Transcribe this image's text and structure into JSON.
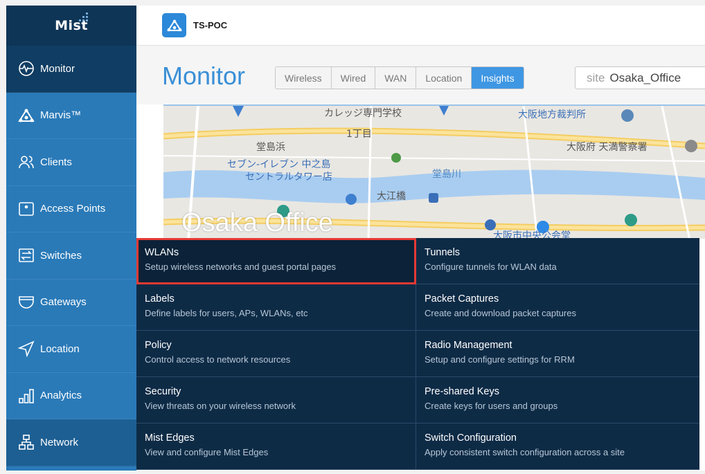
{
  "logo": {
    "text": "Mist"
  },
  "sidebar": {
    "items": [
      {
        "label": "Monitor",
        "icon": "monitor-icon",
        "state": "active"
      },
      {
        "label": "Marvis™",
        "icon": "marvis-icon",
        "state": ""
      },
      {
        "label": "Clients",
        "icon": "clients-icon",
        "state": ""
      },
      {
        "label": "Access Points",
        "icon": "access-point-icon",
        "state": ""
      },
      {
        "label": "Switches",
        "icon": "switch-icon",
        "state": ""
      },
      {
        "label": "Gateways",
        "icon": "gateway-icon",
        "state": ""
      },
      {
        "label": "Location",
        "icon": "location-icon",
        "state": ""
      },
      {
        "label": "Analytics",
        "icon": "analytics-icon",
        "state": ""
      },
      {
        "label": "Network",
        "icon": "network-icon",
        "state": "hover"
      }
    ]
  },
  "topbar": {
    "org_name": "TS-POC"
  },
  "header": {
    "title": "Monitor",
    "tabs": [
      "Wireless",
      "Wired",
      "WAN",
      "Location",
      "Insights"
    ],
    "active_tab": "Insights",
    "site_label": "site",
    "site_value": "Osaka_Office"
  },
  "map": {
    "site_title": "Osaka Office",
    "labels": {
      "l1": "カレッジ専門学校",
      "l2": "大阪地方裁判所",
      "l3": "1丁目",
      "l4": "堂島浜",
      "l5": "大阪府 天満警察署",
      "l6": "セブン-イレブン 中之島",
      "l7": "セントラルタワー店",
      "l8": "堂島川",
      "l9": "大江橋",
      "l10": "大阪市中央公会堂"
    }
  },
  "menu": {
    "items": [
      {
        "title": "WLANs",
        "desc": "Setup wireless networks and guest portal pages"
      },
      {
        "title": "Tunnels",
        "desc": "Configure tunnels for WLAN data"
      },
      {
        "title": "Labels",
        "desc": "Define labels for users, APs, WLANs, etc"
      },
      {
        "title": "Packet Captures",
        "desc": "Create and download packet captures"
      },
      {
        "title": "Policy",
        "desc": "Control access to network resources"
      },
      {
        "title": "Radio Management",
        "desc": "Setup and configure settings for RRM"
      },
      {
        "title": "Security",
        "desc": "View threats on your wireless network"
      },
      {
        "title": "Pre-shared Keys",
        "desc": "Create keys for users and groups"
      },
      {
        "title": "Mist Edges",
        "desc": "View and configure Mist Edges"
      },
      {
        "title": "Switch Configuration",
        "desc": "Apply consistent switch configuration across a site"
      }
    ],
    "highlighted": "WLANs"
  },
  "colors": {
    "sidebar_bg": "#2a7ab8",
    "sidebar_active": "#0f3d63",
    "dropdown_bg": "#0e2b46",
    "accent": "#3f97e3",
    "highlight_outline": "#e53a35"
  }
}
